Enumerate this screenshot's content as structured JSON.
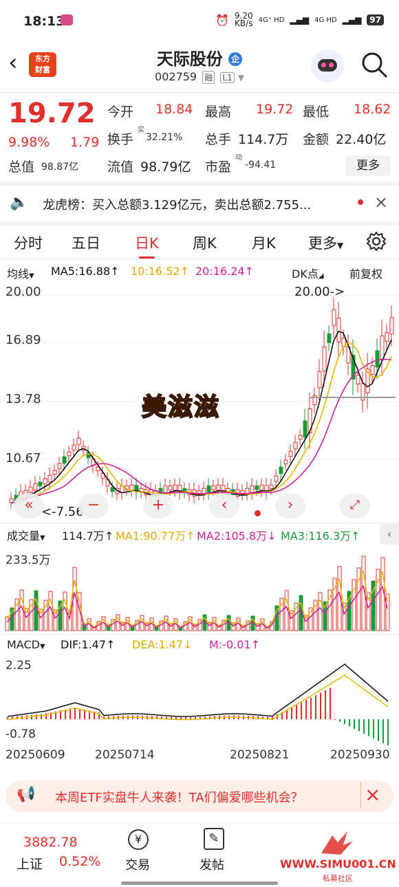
{
  "status": {
    "time": "18:13",
    "net_speed": "9.20",
    "net_unit": "KB/s",
    "signal1": "4G⁺ HD",
    "signal2": "4G HD",
    "battery": "97"
  },
  "header": {
    "logo_line1": "东方",
    "logo_line2": "财富",
    "stock_name": "天际股份",
    "badge": "企",
    "code": "002759",
    "tag1": "融",
    "tag2": "L1"
  },
  "quote": {
    "price": "19.72",
    "change_pct": "9.98%",
    "change": "1.79",
    "open_label": "今开",
    "open": "18.84",
    "high_label": "最高",
    "high": "19.72",
    "low_label": "最低",
    "low": "18.62",
    "turnover_label": "换手",
    "turnover_sup": "实",
    "turnover": "32.21%",
    "volume_label": "总手",
    "volume": "114.7万",
    "amount_label": "金额",
    "amount": "22.40亿",
    "mcap_label": "总值",
    "mcap": "98.87亿",
    "float_label": "流值",
    "float_mcap": "98.79亿",
    "pe_label": "市盈",
    "pe_sup": "动",
    "pe": "-94.41",
    "more": "更多"
  },
  "lhb": {
    "text": "龙虎榜：买入总额3.129亿元，卖出总额2.755..."
  },
  "tabs": [
    "分时",
    "五日",
    "日K",
    "周K",
    "月K",
    "更多"
  ],
  "active_tab": "日K",
  "ma_bar": {
    "selector": "均线",
    "ma5": "MA5:16.88",
    "ma10": "10:16.52",
    "ma20": "20:16.24",
    "dk": "DK点",
    "fq": "前复权"
  },
  "kline": {
    "y_labels": [
      "20.00",
      "16.89",
      "13.78",
      "10.67",
      "7.56"
    ],
    "max_marker": "20.00->",
    "min_marker": "7.56",
    "sticker": "美滋滋"
  },
  "volume_bar": {
    "label": "成交量",
    "vol": "114.7万",
    "ma1": "MA1:90.77万",
    "ma2": "MA2:105.8万",
    "ma3": "MA3:116.3万",
    "ymax": "233.5万"
  },
  "macd_bar": {
    "label": "MACD",
    "dif": "DIF:1.47",
    "dea": "DEA:1.47",
    "m": "M:-0.01",
    "ymax": "2.25",
    "ymin": "-0.78"
  },
  "dates": [
    "20250609",
    "20250714",
    "20250821",
    "20250930"
  ],
  "banner": {
    "text": "本周ETF实盘牛人来袭！TA们偏爱哪些机会？"
  },
  "bottom": {
    "index_value": "3882.78",
    "index_name": "上证",
    "index_change": "0.52%",
    "trade": "交易",
    "post": "发帖"
  },
  "watermark": {
    "site": "WWW.SIMU001.CN",
    "sub": "私募社区"
  },
  "colors": {
    "up": "#e0302c",
    "down": "#1a9a3a",
    "ma5": "#111111",
    "ma10": "#e6b800",
    "ma20": "#d0209a"
  }
}
